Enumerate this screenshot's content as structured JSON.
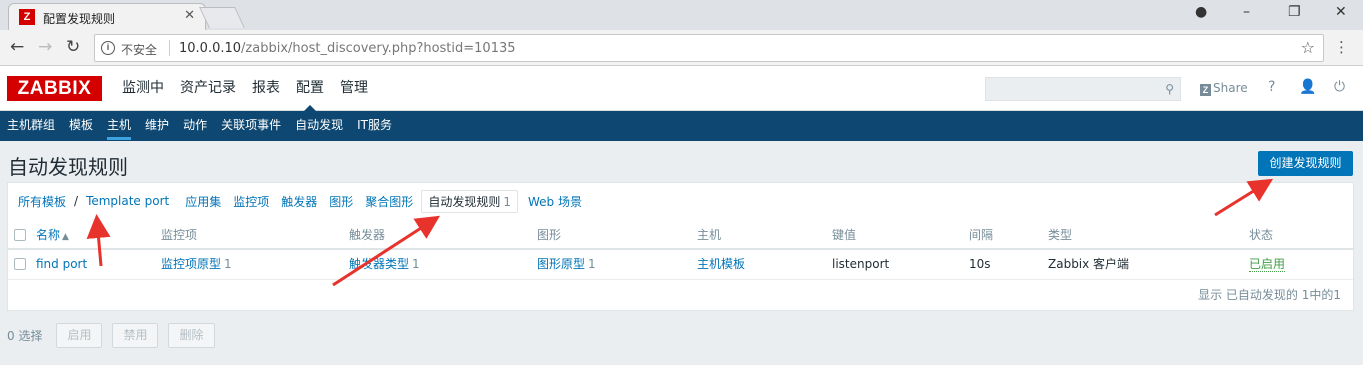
{
  "browser": {
    "tab_title": "配置发现规则",
    "tab_icon": "zabbix-favicon",
    "omnibox": {
      "security_label": "不安全",
      "url_host": "10.0.0.10",
      "url_path": "/zabbix/host_discovery.php?hostid=10135"
    }
  },
  "header": {
    "logo": "ZABBIX",
    "menu": [
      {
        "label": "监测中"
      },
      {
        "label": "资产记录"
      },
      {
        "label": "报表"
      },
      {
        "label": "配置",
        "selected": true
      },
      {
        "label": "管理"
      }
    ],
    "search_placeholder": "",
    "share_label": "Share",
    "help_label": "?"
  },
  "sub_menu": [
    {
      "label": "主机群组"
    },
    {
      "label": "模板"
    },
    {
      "label": "主机",
      "selected": true
    },
    {
      "label": "维护"
    },
    {
      "label": "动作"
    },
    {
      "label": "关联项事件"
    },
    {
      "label": "自动发现"
    },
    {
      "label": "IT服务"
    }
  ],
  "page": {
    "title": "自动发现规则",
    "create_button": "创建发现规则"
  },
  "breadcrumbs": {
    "all_templates": "所有模板",
    "separator": "/",
    "template": "Template port",
    "tabs": [
      {
        "label": "应用集",
        "count": ""
      },
      {
        "label": "监控项",
        "count": ""
      },
      {
        "label": "触发器",
        "count": ""
      },
      {
        "label": "图形",
        "count": ""
      },
      {
        "label": "聚合图形",
        "count": ""
      },
      {
        "label": "自动发现规则",
        "count": "1",
        "selected": true
      },
      {
        "label": "Web 场景",
        "count": ""
      }
    ]
  },
  "table": {
    "columns": [
      "名称",
      "监控项",
      "触发器",
      "图形",
      "主机",
      "键值",
      "间隔",
      "类型",
      "状态"
    ],
    "rows": [
      {
        "name": "find port",
        "items": "监控项原型",
        "items_count": "1",
        "triggers": "触发器类型",
        "triggers_count": "1",
        "graphs": "图形原型",
        "graphs_count": "1",
        "hosts": "主机模板",
        "key": "listenport",
        "interval": "10s",
        "type": "Zabbix 客户端",
        "status": "已启用"
      }
    ],
    "footer": "显示 已自动发现的 1中的1"
  },
  "actions": {
    "selected_count": "0 选择",
    "enable": "启用",
    "disable": "禁用",
    "delete": "删除"
  },
  "colors": {
    "brand_red": "#d40000",
    "nav_blue": "#0e4872",
    "link_blue": "#0275b8",
    "status_green": "#429e47",
    "annotation_red": "#e8322c"
  }
}
